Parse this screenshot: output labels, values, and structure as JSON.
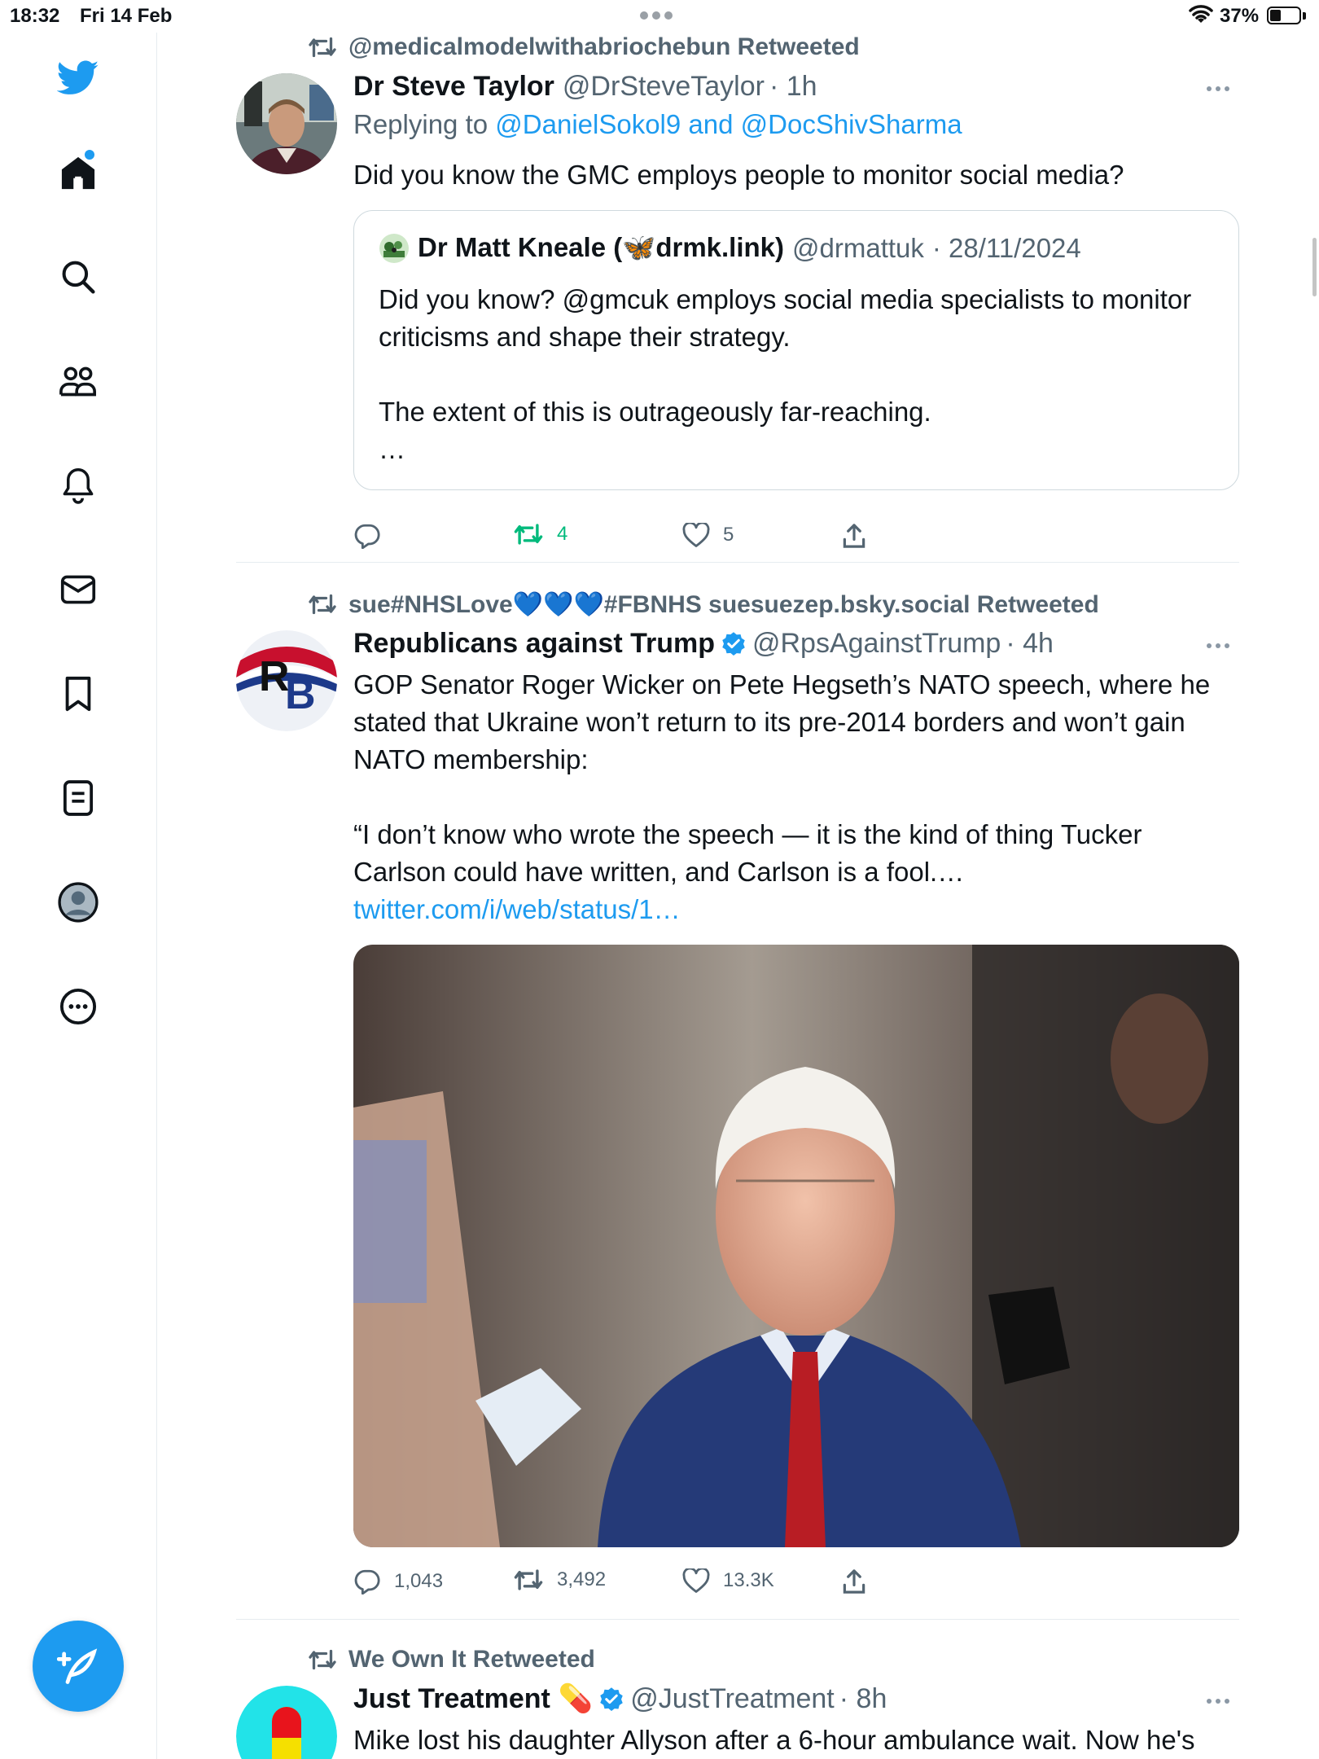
{
  "status_bar": {
    "time": "18:32",
    "date": "Fri 14 Feb",
    "battery_text": "37%",
    "battery_level": 0.37
  },
  "sidebar": {
    "items": [
      {
        "icon": "twitter-logo-icon"
      },
      {
        "icon": "home-icon",
        "has_notification_dot": true
      },
      {
        "icon": "search-icon"
      },
      {
        "icon": "communities-icon"
      },
      {
        "icon": "bell-icon"
      },
      {
        "icon": "mail-icon"
      },
      {
        "icon": "bookmark-icon"
      },
      {
        "icon": "lists-icon"
      },
      {
        "icon": "profile-icon"
      },
      {
        "icon": "more-circle-icon"
      }
    ],
    "compose_icon": "compose-tweet-icon",
    "accent_color": "#1d9bf0"
  },
  "tweets": [
    {
      "retweeted_by": "@medicalmodelwithabriochebun Retweeted",
      "name": "Dr Steve Taylor",
      "handle": "@DrSteveTaylor",
      "time": "· 1h",
      "replying_label": "Replying to",
      "replying_to": "@DanielSokol9 and @DocShivSharma",
      "text": "Did you know the GMC employs people to monitor social media?",
      "quote": {
        "name_prefix": "Dr Matt Kneale (",
        "butterfly": "🦋",
        "name_suffix": "drmk.link)",
        "handle": "@drmattuk",
        "time": "· 28/11/2024",
        "text": "Did you know? @gmcuk employs social media specialists to monitor criticisms and shape their strategy.\n\nThe extent of this is outrageously far-reaching.\n…"
      },
      "replies": "",
      "retweets": "4",
      "likes": "5"
    },
    {
      "retweeted_by": "sue#NHSLove💙💙💙#FBNHS suesuezep.bsky.social Retweeted",
      "name": "Republicans against Trump",
      "handle": "@RpsAgainstTrump",
      "time": "· 4h",
      "avatar_letters": "RB",
      "text": "GOP Senator Roger Wicker on Pete Hegseth’s NATO speech, where he stated that Ukraine won’t return to its pre-2014 borders and won’t gain NATO membership:\n\n“I don’t know who wrote the speech — it is the kind of thing Tucker Carlson could have written, and Carlson is a fool.… ",
      "link": "twitter.com/i/web/status/1…",
      "replies": "1,043",
      "retweets": "3,492",
      "likes": "13.3K"
    },
    {
      "retweeted_by": "We Own It Retweeted",
      "name": "Just Treatment",
      "name_emoji": "💊",
      "handle": "@JustTreatment",
      "time": "· 8h",
      "text": "Mike lost his daughter Allyson after a 6-hour ambulance wait. Now he's"
    }
  ]
}
